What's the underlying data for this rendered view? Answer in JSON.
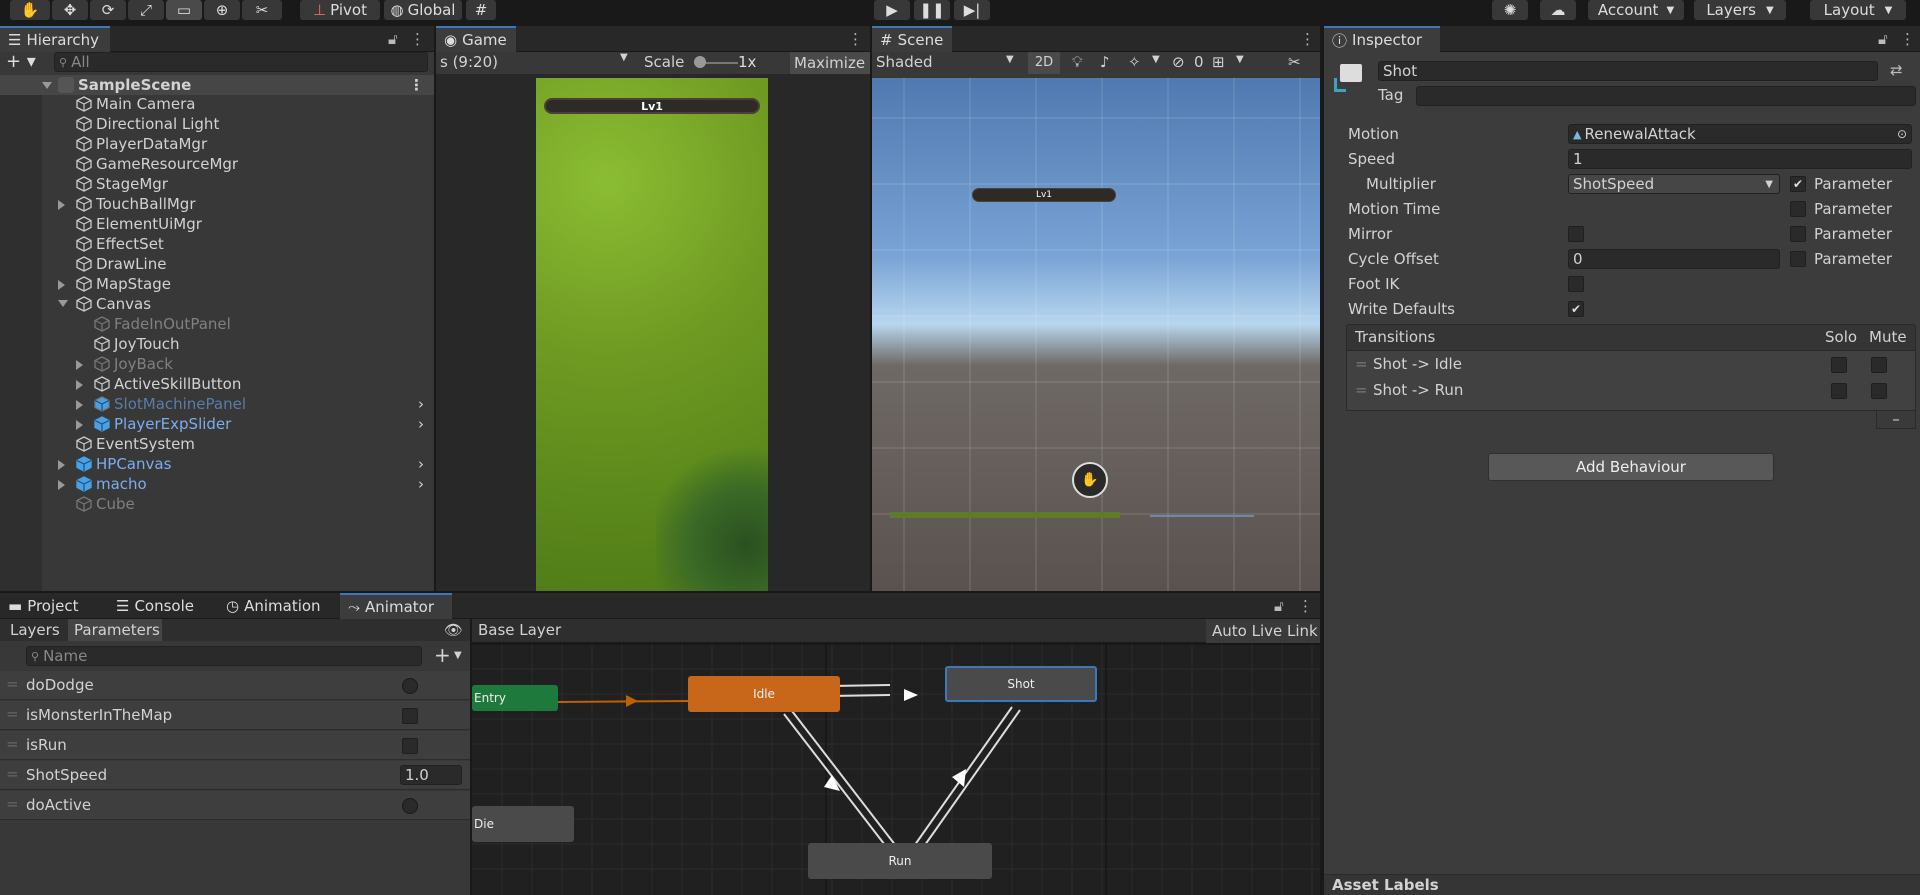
{
  "toolbar": {
    "pivot": "Pivot",
    "global": "Global",
    "account": "Account",
    "layers": "Layers",
    "layout": "Layout"
  },
  "hierarchy": {
    "tab": "Hierarchy",
    "search_placeholder": "All",
    "scene": "SampleScene",
    "items": [
      {
        "label": "Main Camera"
      },
      {
        "label": "Directional Light"
      },
      {
        "label": "PlayerDataMgr"
      },
      {
        "label": "GameResourceMgr"
      },
      {
        "label": "StageMgr"
      },
      {
        "label": "TouchBallMgr"
      },
      {
        "label": "ElementUiMgr"
      },
      {
        "label": "EffectSet"
      },
      {
        "label": "DrawLine"
      },
      {
        "label": "MapStage"
      },
      {
        "label": "Canvas"
      },
      {
        "label": "FadeInOutPanel"
      },
      {
        "label": "JoyTouch"
      },
      {
        "label": "JoyBack"
      },
      {
        "label": "ActiveSkillButton"
      },
      {
        "label": "SlotMachinePanel"
      },
      {
        "label": "PlayerExpSlider"
      },
      {
        "label": "EventSystem"
      },
      {
        "label": "HPCanvas"
      },
      {
        "label": "macho"
      },
      {
        "label": "Cube"
      }
    ]
  },
  "game": {
    "tab": "Game",
    "resolution": "s (9:20)",
    "scale_label": "Scale",
    "scale_value": "1x",
    "maximize": "Maximize",
    "level_badge": "Lv1"
  },
  "scene_view": {
    "tab": "Scene",
    "shading": "Shaded",
    "mode_2d": "2D",
    "hidden_count": "0",
    "level_badge": "Lv1"
  },
  "inspector": {
    "tab": "Inspector",
    "name": "Shot",
    "tag_label": "Tag",
    "tag_value": "",
    "props": {
      "motion_label": "Motion",
      "motion_value": "RenewalAttack",
      "speed_label": "Speed",
      "speed_value": "1",
      "multiplier_label": "Multiplier",
      "multiplier_value": "ShotSpeed",
      "motion_time_label": "Motion Time",
      "mirror_label": "Mirror",
      "cycle_offset_label": "Cycle Offset",
      "cycle_offset_value": "0",
      "foot_ik_label": "Foot IK",
      "write_defaults_label": "Write Defaults",
      "parameter_label": "Parameter"
    },
    "transitions": {
      "header": "Transitions",
      "solo": "Solo",
      "mute": "Mute",
      "rows": [
        {
          "label": "Shot -> Idle"
        },
        {
          "label": "Shot -> Run"
        }
      ],
      "remove": "–"
    },
    "add_behaviour": "Add Behaviour",
    "asset_labels": "Asset Labels"
  },
  "bottom": {
    "tabs": [
      {
        "label": "Project"
      },
      {
        "label": "Console"
      },
      {
        "label": "Animation"
      },
      {
        "label": "Animator"
      }
    ],
    "layers_tab": "Layers",
    "parameters_tab": "Parameters",
    "search_placeholder": "Name",
    "params": [
      {
        "name": "doDodge",
        "type": "trigger"
      },
      {
        "name": "isMonsterInTheMap",
        "type": "bool"
      },
      {
        "name": "isRun",
        "type": "bool"
      },
      {
        "name": "ShotSpeed",
        "type": "float",
        "value": "1.0"
      },
      {
        "name": "doActive",
        "type": "trigger"
      }
    ],
    "base_layer": "Base Layer",
    "auto_live_link": "Auto Live Link",
    "nodes": {
      "entry": "Entry",
      "idle": "Idle",
      "shot": "Shot",
      "run": "Run",
      "die": "Die"
    }
  },
  "colors": {
    "accent": "#3a79bb",
    "entry_node": "#1e7a3c",
    "idle_node": "#c8671a",
    "prefab_text": "#7cacee"
  }
}
